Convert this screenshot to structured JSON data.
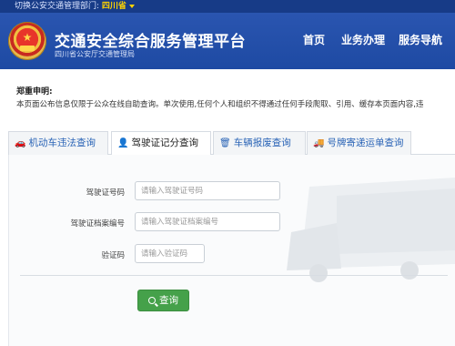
{
  "topbar": {
    "switch_label": "切换公安交通管理部门:",
    "province": "四川省"
  },
  "header": {
    "title": "交通安全综合服务管理平台",
    "subtitle": "四川省公安厅交通管理局",
    "nav": [
      "首页",
      "业务办理",
      "服务导航"
    ]
  },
  "disclaimer": {
    "title": "郑重申明:",
    "text": "本页面公布信息仅限于公众在线自助查询。单次使用,任何个人和组织不得通过任何手段爬取、引用、缓存本页面内容,违"
  },
  "tabs": [
    {
      "label": "机动车违法查询",
      "icon": "car-icon"
    },
    {
      "label": "驾驶证记分查询",
      "icon": "user-icon"
    },
    {
      "label": "车辆报废查询",
      "icon": "trash-icon"
    },
    {
      "label": "号牌寄递运单查询",
      "icon": "truck-icon"
    }
  ],
  "form": {
    "license_no": {
      "label": "驾驶证号码",
      "placeholder": "请输入驾驶证号码"
    },
    "file_no": {
      "label": "驾驶证档案编号",
      "placeholder": "请输入驾驶证档案编号"
    },
    "captcha": {
      "label": "验证码",
      "placeholder": "请输入验证码"
    },
    "submit_label": "查询"
  },
  "colors": {
    "topbar": "#173b87",
    "header": "#2a55b0",
    "accent": "#2a64b6",
    "button": "#45a14a"
  }
}
